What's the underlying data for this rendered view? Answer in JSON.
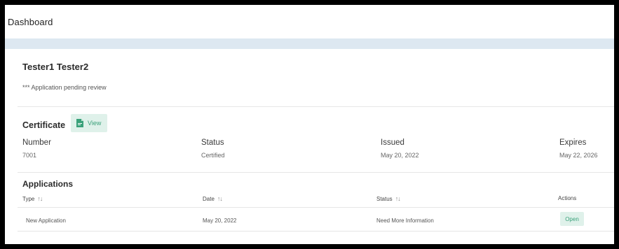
{
  "header": {
    "title": "Dashboard"
  },
  "profile": {
    "name": "Tester1 Tester2",
    "notice": "*** Application pending review"
  },
  "certificate": {
    "title": "Certificate",
    "view_label": "View",
    "columns": [
      {
        "label": "Number",
        "value": "7001"
      },
      {
        "label": "Status",
        "value": "Certified"
      },
      {
        "label": "Issued",
        "value": "May 20, 2022"
      },
      {
        "label": "Expires",
        "value": "May 22, 2026"
      }
    ]
  },
  "applications": {
    "title": "Applications",
    "headers": [
      "Type",
      "Date",
      "Status",
      "Actions"
    ],
    "rows": [
      {
        "type": "New Application",
        "date": "May 20, 2022",
        "status": "Need More Information",
        "action": "Open"
      }
    ]
  },
  "colors": {
    "accent": "#3aa17a",
    "accent_bg": "#dff1ea",
    "band": "#dde8f1"
  },
  "icons": {
    "view": "pdf-file-icon",
    "sort": "sort-arrows-icon"
  }
}
